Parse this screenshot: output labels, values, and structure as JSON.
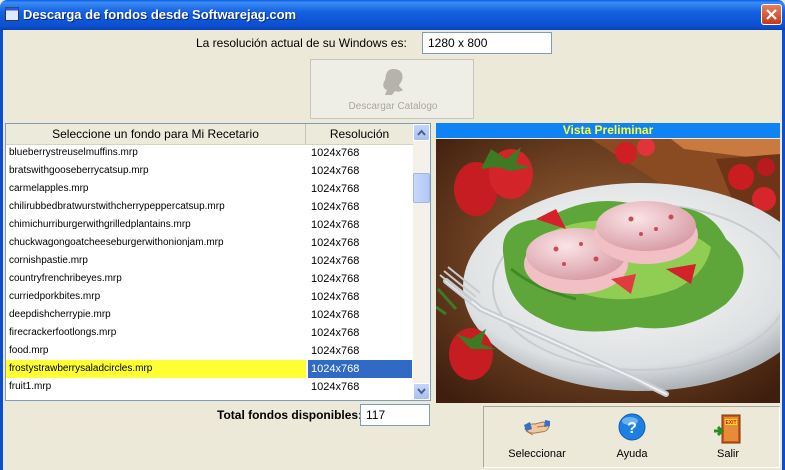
{
  "window": {
    "title": "Descarga de fondos desde Softwarejag.com"
  },
  "resolution": {
    "label": "La resolución actual de su Windows es:",
    "value": "1280 x 800"
  },
  "download_button": {
    "label": "Descargar Catalogo"
  },
  "list": {
    "columns": [
      "Seleccione un fondo para Mi Recetario",
      "Resolución"
    ],
    "rows": [
      {
        "name": "blueberrystreuselmuffins.mrp",
        "res": "1024x768"
      },
      {
        "name": "bratswithgooseberrycatsup.mrp",
        "res": "1024x768"
      },
      {
        "name": "carmelapples.mrp",
        "res": "1024x768"
      },
      {
        "name": "chilirubbedbratwurstwithcherrypeppercatsup.mrp",
        "res": "1024x768"
      },
      {
        "name": "chimichurriburgerwithgrilledplantains.mrp",
        "res": "1024x768"
      },
      {
        "name": "chuckwagongoatcheeseburgerwithonionjam.mrp",
        "res": "1024x768"
      },
      {
        "name": "cornishpastie.mrp",
        "res": "1024x768"
      },
      {
        "name": "countryfrenchribeyes.mrp",
        "res": "1024x768"
      },
      {
        "name": "curriedporkbites.mrp",
        "res": "1024x768"
      },
      {
        "name": "deepdishcherrypie.mrp",
        "res": "1024x768"
      },
      {
        "name": "firecrackerfootlongs.mrp",
        "res": "1024x768"
      },
      {
        "name": "food.mrp",
        "res": "1024x768"
      },
      {
        "name": "frostystrawberrysaladcircles.mrp",
        "res": "1024x768",
        "selected": true
      },
      {
        "name": "fruit1.mrp",
        "res": "1024x768"
      }
    ]
  },
  "total": {
    "label": "Total fondos disponibles:",
    "value": "117"
  },
  "preview": {
    "title": "Vista Preliminar"
  },
  "buttons": {
    "select": "Seleccionar",
    "help": "Ayuda",
    "exit": "Salir",
    "exit_sign": "EXIT"
  },
  "colors": {
    "titlebar": "#0b4fd0",
    "preview_header": "#0f83f5",
    "preview_title_text": "#ffff33",
    "selection_name": "#ffff33",
    "selection_res": "#316ac5"
  }
}
